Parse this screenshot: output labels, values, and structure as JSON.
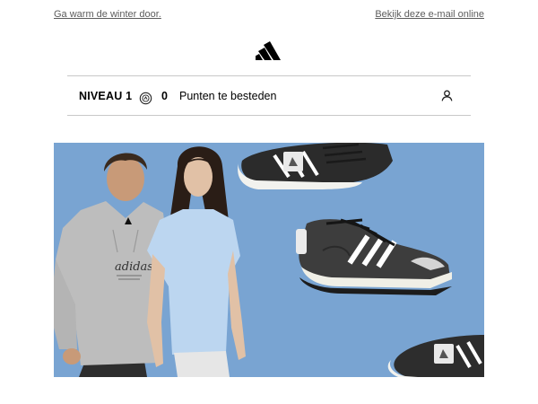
{
  "header": {
    "winter_link": "Ga warm de winter door.",
    "view_online_link": "Bekijk deze e-mail online"
  },
  "brand": {
    "logo_icon": "adidas-logo-icon"
  },
  "loyalty_bar": {
    "level_label": "NIVEAU 1",
    "coin_icon": "points-coin-icon",
    "points_value": "0",
    "points_text": "Punten te besteden",
    "account_icon": "user-icon"
  },
  "hero": {
    "background_color": "#79a4d2",
    "hoodie_print": "adidas"
  }
}
